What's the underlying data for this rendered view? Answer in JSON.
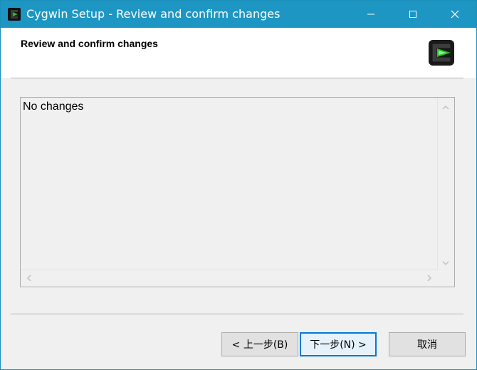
{
  "window": {
    "title": "Cygwin Setup - Review and confirm changes"
  },
  "header": {
    "title": "Review and confirm changes"
  },
  "content": {
    "text": "No changes"
  },
  "buttons": {
    "back": "< 上一步(B)",
    "next": "下一步(N) >",
    "cancel": "取消"
  },
  "colors": {
    "titlebar": "#1d96c3",
    "accent_focus": "#0078d7",
    "logo_green": "#22c322"
  },
  "icons": {
    "app": "cygwin-icon",
    "minimize": "minimize-icon",
    "maximize": "maximize-icon",
    "close": "close-icon",
    "logo": "cygwin-logo"
  }
}
